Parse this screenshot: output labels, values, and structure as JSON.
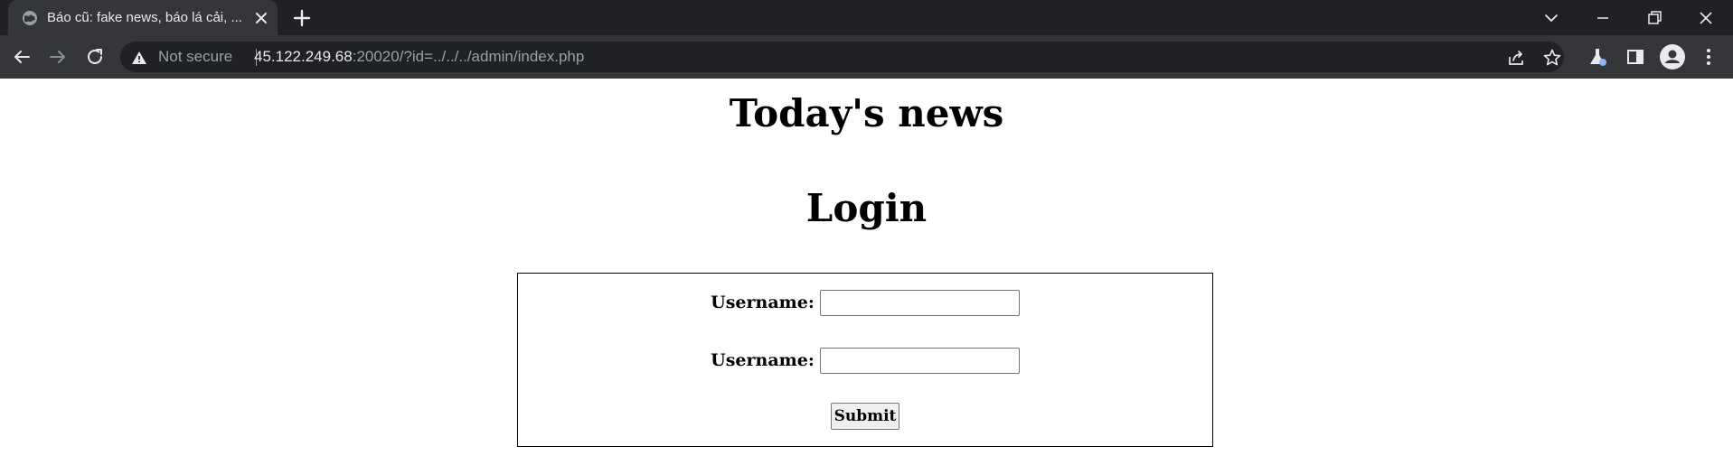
{
  "browser": {
    "tab": {
      "title": "Báo cũ: fake news, báo lá cải, ..."
    },
    "address_bar": {
      "security_label": "Not secure",
      "url_host": "45.122.249.68",
      "url_rest": ":20020/?id=../../../admin/index.php"
    }
  },
  "page": {
    "site_title": "Today's news",
    "login_title": "Login",
    "form": {
      "fields": [
        {
          "label": "Username:",
          "value": ""
        },
        {
          "label": "Username:",
          "value": ""
        }
      ],
      "submit_label": "Submit"
    }
  }
}
